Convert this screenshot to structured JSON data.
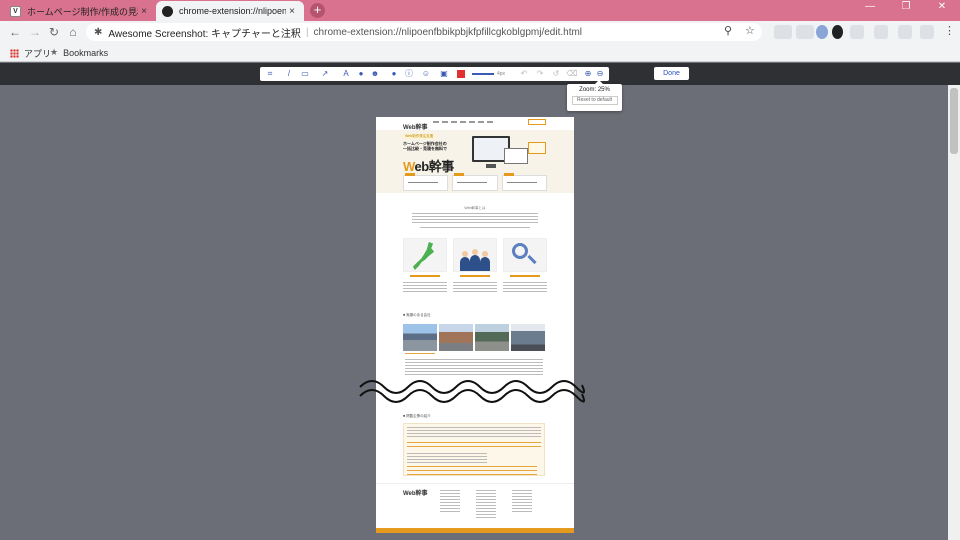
{
  "browser": {
    "tabs": [
      {
        "title": "ホームページ制作/作成の見積・発注",
        "favicon": "V",
        "active": false
      },
      {
        "title": "chrome-extension://nlipoenfb",
        "favicon": "circle",
        "active": true
      }
    ],
    "new_tab_symbol": "+",
    "close_symbol": "×",
    "window_controls": {
      "minimize": "—",
      "maximize": "❐",
      "close": "✕"
    },
    "address": {
      "site_name": "Awesome Screenshot: キャプチャーと注釈",
      "separator": "|",
      "url": "chrome-extension://nlipoenfbbikpbjkfpfillcgkoblgpmj/edit.html"
    },
    "bookmarks": [
      {
        "label": "アプリ",
        "icon": "apps-grid-icon"
      },
      {
        "label": "Bookmarks",
        "icon": "star-icon"
      }
    ]
  },
  "editor": {
    "tools": [
      {
        "name": "crop",
        "glyph": "⌗"
      },
      {
        "name": "pen",
        "glyph": "/"
      },
      {
        "name": "rectangle",
        "glyph": "▭"
      },
      {
        "name": "arrow",
        "glyph": "↗"
      },
      {
        "name": "text",
        "glyph": "A"
      },
      {
        "name": "blur",
        "glyph": "●"
      },
      {
        "name": "sticker",
        "glyph": "☻"
      },
      {
        "name": "comment",
        "glyph": "●"
      },
      {
        "name": "info",
        "glyph": "ⓘ"
      },
      {
        "name": "emoji",
        "glyph": "☺"
      },
      {
        "name": "image",
        "glyph": "▣"
      }
    ],
    "color": "#e03030",
    "line_width_label": "4px",
    "history_tools": [
      "↶",
      "↷",
      "↺",
      "⌫"
    ],
    "zoom_in": "⊕",
    "zoom_out": "⊖",
    "done_label": "Done",
    "zoom_popup": {
      "zoom_label": "Zoom: 25%",
      "reset_label": "Reset to default"
    }
  },
  "preview": {
    "header_logo": "Web幹事",
    "hero_badge": "Web制作発注支援",
    "hero_copy": "ホームページ制作会社の\n一括比較・見積を無料で",
    "hero_logo_prefix": "W",
    "hero_logo_rest": "eb幹事",
    "section_title": "Web幹事とは",
    "sub_head_1": "■ 実績のある会社",
    "sub_head_2": "■ 掲載企業の紹介",
    "footer_logo": "Web幹事"
  }
}
